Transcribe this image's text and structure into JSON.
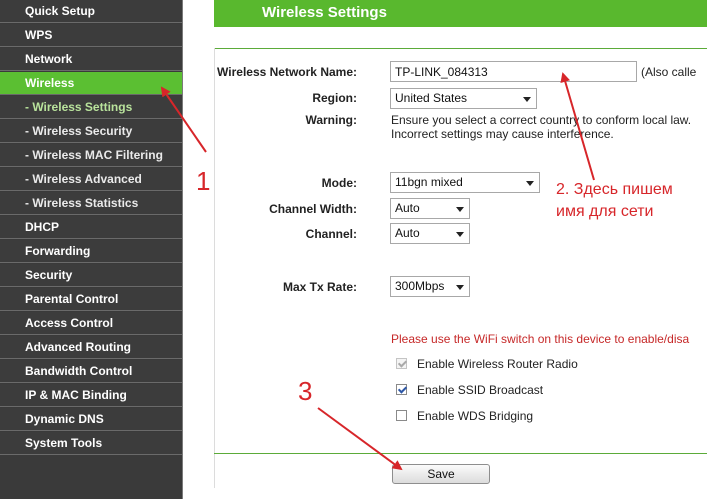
{
  "sidebar": {
    "items": [
      {
        "label": "Quick Setup"
      },
      {
        "label": "WPS"
      },
      {
        "label": "Network"
      },
      {
        "label": "Wireless"
      },
      {
        "label": "- Wireless Settings"
      },
      {
        "label": "- Wireless Security"
      },
      {
        "label": "- Wireless MAC Filtering"
      },
      {
        "label": "- Wireless Advanced"
      },
      {
        "label": "- Wireless Statistics"
      },
      {
        "label": "DHCP"
      },
      {
        "label": "Forwarding"
      },
      {
        "label": "Security"
      },
      {
        "label": "Parental Control"
      },
      {
        "label": "Access Control"
      },
      {
        "label": "Advanced Routing"
      },
      {
        "label": "Bandwidth Control"
      },
      {
        "label": "IP & MAC Binding"
      },
      {
        "label": "Dynamic DNS"
      },
      {
        "label": "System Tools"
      }
    ]
  },
  "page": {
    "title": "Wireless Settings"
  },
  "form": {
    "ssid_label": "Wireless Network Name:",
    "ssid_value": "TP-LINK_084313",
    "ssid_note": "(Also calle",
    "region_label": "Region:",
    "region_value": "United States",
    "warning_label": "Warning:",
    "warning_line1": "Ensure you select a correct country to conform local law.",
    "warning_line2": "Incorrect settings may cause interference.",
    "mode_label": "Mode:",
    "mode_value": "11bgn mixed",
    "channel_width_label": "Channel Width:",
    "channel_width_value": "Auto",
    "channel_label": "Channel:",
    "channel_value": "Auto",
    "max_tx_label": "Max Tx Rate:",
    "max_tx_value": "300Mbps",
    "wifi_switch_note": "Please use the WiFi switch on this device to enable/disa",
    "enable_radio_label": "Enable Wireless Router Radio",
    "enable_ssid_label": "Enable SSID Broadcast",
    "enable_wds_label": "Enable WDS Bridging",
    "save_label": "Save"
  },
  "annotations": {
    "marker1": "1",
    "marker2_line1": "2. Здесь пишем",
    "marker2_line2": "имя для сети",
    "marker3": "3",
    "color": "#d7262a"
  },
  "colors": {
    "accent_green": "#59b82e",
    "sidebar_bg": "#3c3c3c",
    "warning_red": "#c62828"
  }
}
